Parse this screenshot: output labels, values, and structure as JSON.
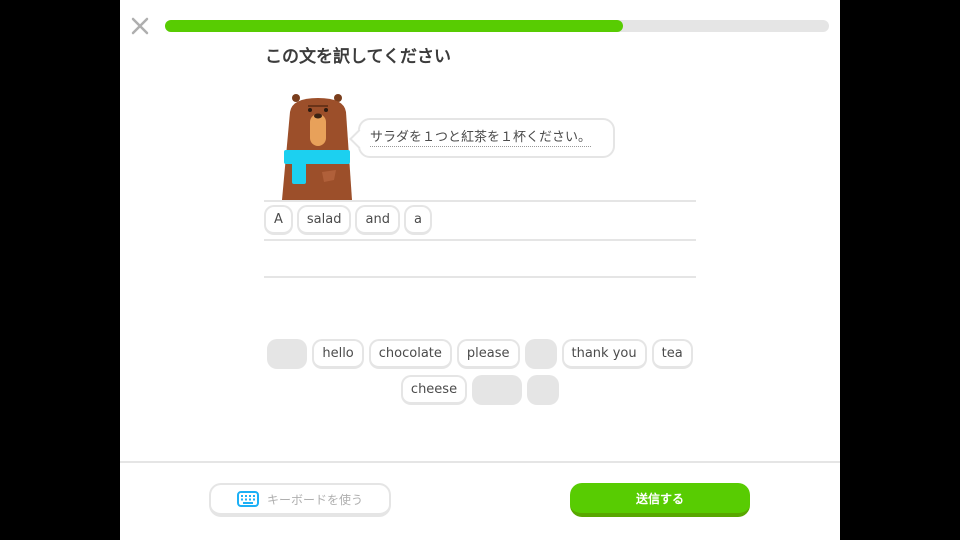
{
  "header": {
    "progress_percent": 69
  },
  "prompt": {
    "title": "この文を訳してください",
    "sentence": "サラダを１つと紅茶を１杯ください。"
  },
  "answer": {
    "words": [
      "A",
      "salad",
      "and",
      "a"
    ]
  },
  "word_bank": {
    "row1": [
      {
        "label": "",
        "used": true
      },
      {
        "label": "hello",
        "used": false
      },
      {
        "label": "chocolate",
        "used": false
      },
      {
        "label": "please",
        "used": false
      },
      {
        "label": "",
        "used": true
      },
      {
        "label": "thank you",
        "used": false
      },
      {
        "label": "tea",
        "used": false
      }
    ],
    "row2": [
      {
        "label": "cheese",
        "used": false
      },
      {
        "label": "",
        "used": true
      },
      {
        "label": "",
        "used": true
      }
    ]
  },
  "footer": {
    "keyboard_label": "キーボードを使う",
    "submit_label": "送信する"
  },
  "colors": {
    "accent": "#58cc02",
    "bear": "#a0522d",
    "scarf": "#1cb0f6"
  }
}
